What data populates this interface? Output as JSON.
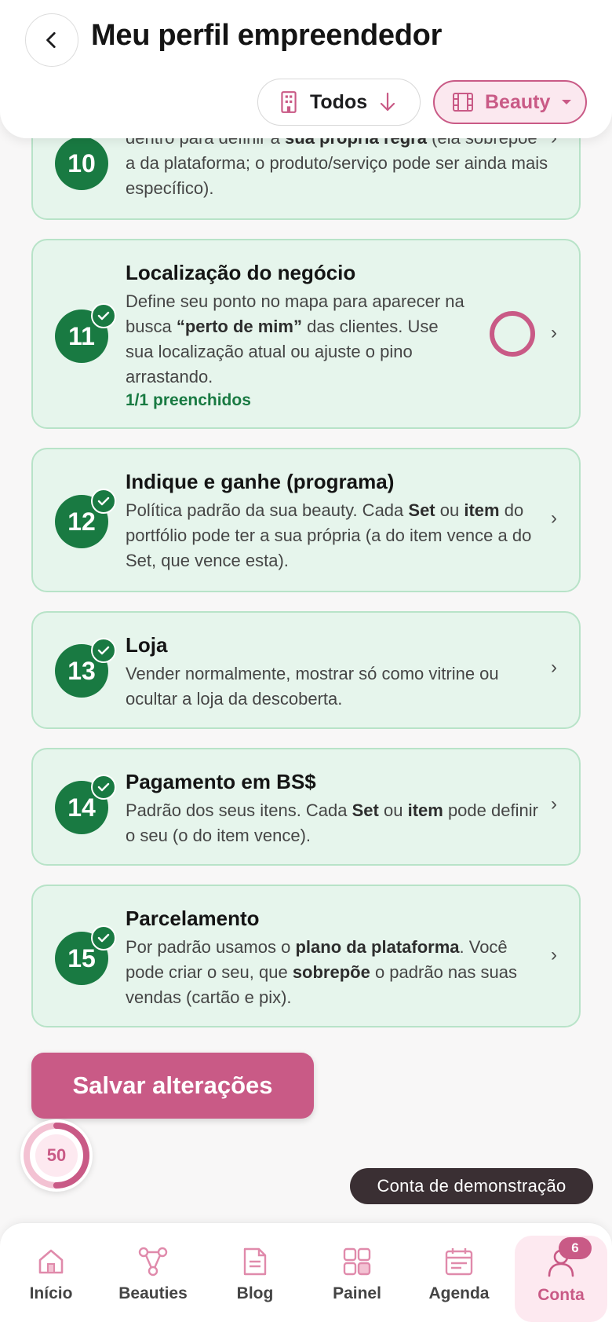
{
  "header": {
    "title": "Meu perfil empreendedor",
    "filter_all_label": "Todos",
    "filter_beauty_label": "Beauty"
  },
  "cards": [
    {
      "number": "10",
      "desc_html_parts": [
        "dentro para definir a ",
        "sua própria regra",
        " (ela sobrepõe a da plataforma; o produto/serviço pode ser ainda mais específico)."
      ]
    },
    {
      "number": "11",
      "title": "Localização do negócio",
      "desc_a": "Define seu ponto no mapa para aparecer na busca ",
      "desc_b": "“perto de mim”",
      "desc_c": " das clientes. Use sua localização atual ou ajuste o pino arrastando.",
      "progress": "1/1 preenchidos"
    },
    {
      "number": "12",
      "title": "Indique e ganhe (programa)",
      "desc_a": "Política padrão da sua beauty. Cada ",
      "desc_b": "Set",
      "desc_c": " ou ",
      "desc_d": "item",
      "desc_e": " do portfólio pode ter a sua própria (a do item vence a do Set, que vence esta)."
    },
    {
      "number": "13",
      "title": "Loja",
      "desc": "Vender normalmente, mostrar só como vitrine ou ocultar a loja da descoberta."
    },
    {
      "number": "14",
      "title": "Pagamento em BS$",
      "desc_a": "Padrão dos seus itens. Cada ",
      "desc_b": "Set",
      "desc_c": " ou ",
      "desc_d": "item",
      "desc_e": " pode definir o seu (o do item vence)."
    },
    {
      "number": "15",
      "title": "Parcelamento",
      "desc_a": "Por padrão usamos o ",
      "desc_b": "plano da plataforma",
      "desc_c": ". Você pode criar o seu, que ",
      "desc_d": "sobrepõe",
      "desc_e": " o padrão nas suas vendas (cartão e pix)."
    }
  ],
  "chevron": "›",
  "save_label": "Salvar alterações",
  "score": {
    "value": "50",
    "progress": 0.5
  },
  "demo_badge": "Conta de demonstração",
  "nav": [
    {
      "label": "Início",
      "icon": "home-icon"
    },
    {
      "label": "Beauties",
      "icon": "network-icon"
    },
    {
      "label": "Blog",
      "icon": "document-icon"
    },
    {
      "label": "Painel",
      "icon": "dashboard-icon"
    },
    {
      "label": "Agenda",
      "icon": "calendar-icon"
    },
    {
      "label": "Conta",
      "icon": "user-icon",
      "badge": "6",
      "active": true
    }
  ],
  "colors": {
    "accent": "#c95a86",
    "success": "#197a42",
    "card_bg": "#e6f5ec"
  }
}
